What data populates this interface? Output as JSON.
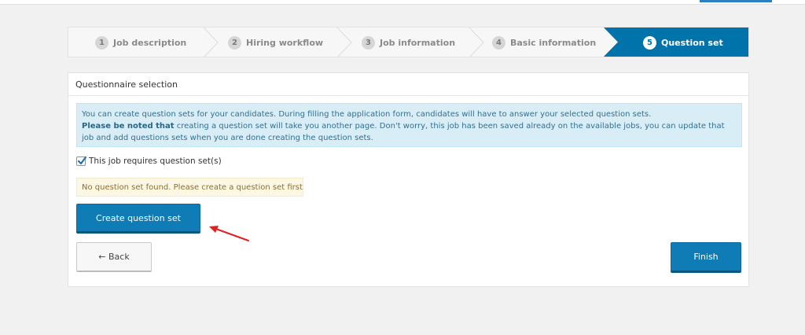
{
  "steps": [
    {
      "number": "1",
      "label": "Job description"
    },
    {
      "number": "2",
      "label": "Hiring workflow"
    },
    {
      "number": "3",
      "label": "Job information"
    },
    {
      "number": "4",
      "label": "Basic information"
    },
    {
      "number": "5",
      "label": "Question set"
    }
  ],
  "active_step_index": 4,
  "panel": {
    "title": "Questionnaire selection",
    "info_line1": "You can create question sets for your candidates. During filling the application form, candidates will have to answer your selected question sets.",
    "info_bold": "Please be noted that",
    "info_line2": " creating a question set will take you another page. Don't worry, this job has been saved already on the available jobs, you can update that job and add questions sets when you are done creating the question sets.",
    "checkbox_label": "This job requires question set(s)",
    "checkbox_checked": true,
    "warning": "No question set found. Please create a question set first",
    "create_button": "Create question set",
    "back_button": "← Back",
    "finish_button": "Finish"
  },
  "colors": {
    "primary": "#0073aa",
    "info_bg": "#d9edf7",
    "warning_bg": "#fcf8e3",
    "annotation_arrow": "#e02020"
  }
}
